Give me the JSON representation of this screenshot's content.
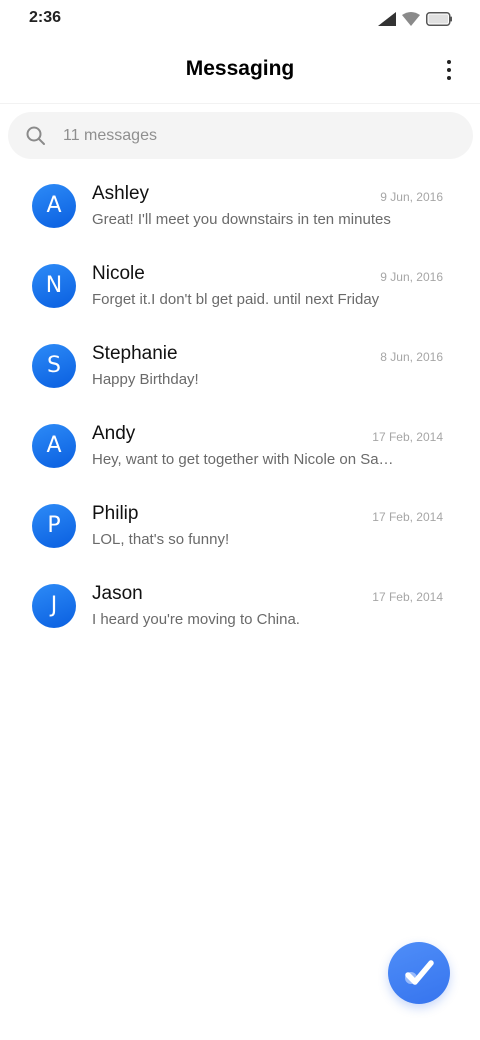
{
  "status_bar": {
    "time": "2:36",
    "icons": [
      "signal-icon",
      "wifi-icon",
      "battery-icon"
    ]
  },
  "app_bar": {
    "title": "Messaging",
    "menu_icon": "more-vertical-icon"
  },
  "search": {
    "placeholder": "11 messages",
    "value": ""
  },
  "conversations": [
    {
      "initial": "A",
      "name": "Ashley",
      "date": "9 Jun, 2016",
      "snippet": "Great! I'll meet you downstairs in ten minutes"
    },
    {
      "initial": "N",
      "name": "Nicole",
      "date": "9 Jun, 2016",
      "snippet": "Forget it.I don't bl get paid. until next Friday"
    },
    {
      "initial": "S",
      "name": "Stephanie",
      "date": "8 Jun, 2016",
      "snippet": "Happy Birthday!"
    },
    {
      "initial": "A",
      "name": "Andy",
      "date": "17 Feb, 2014",
      "snippet": "Hey, want to get together with Nicole on Saturday?"
    },
    {
      "initial": "P",
      "name": "Philip",
      "date": "17 Feb, 2014",
      "snippet": "LOL, that's so funny!"
    },
    {
      "initial": "J",
      "name": "Jason",
      "date": "17 Feb, 2014",
      "snippet": "I heard you're moving to China."
    }
  ],
  "fab": {
    "icon": "check-icon"
  },
  "colors": {
    "accent": "#0a66e6",
    "fab": "#3f7ff2",
    "snippet_text": "#6a6a6a",
    "date_text": "#a6a6a6"
  }
}
